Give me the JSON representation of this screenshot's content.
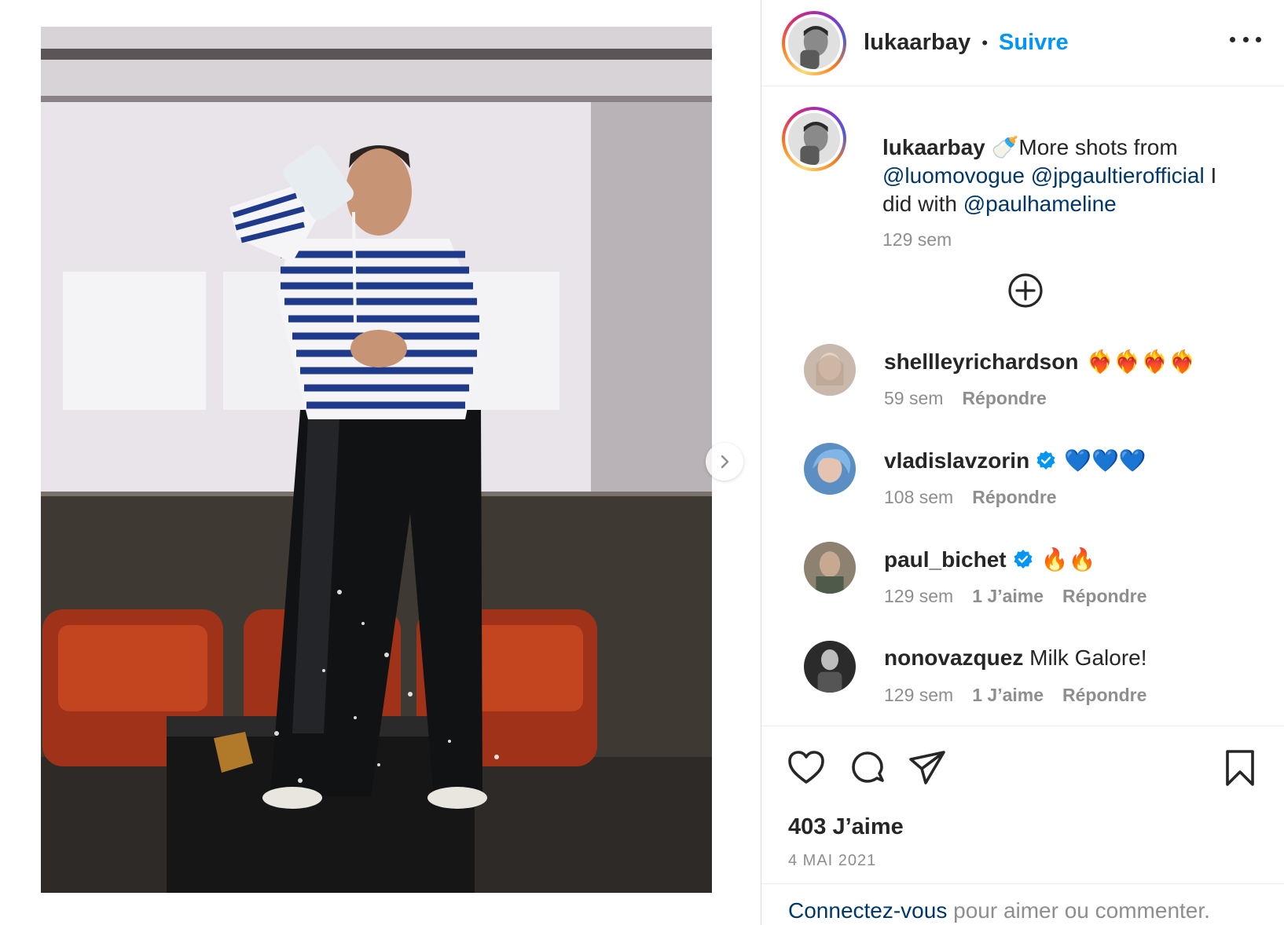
{
  "post": {
    "author": "lukaarbay",
    "separator": "•",
    "follow_label": "Suivre",
    "more_icon": "more-horizontal-icon"
  },
  "caption": {
    "username": "lukaarbay",
    "emoji": "🍼",
    "text_before": "More shots from",
    "mention_1": "@luomovogue",
    "mention_2": "@jpgaultierofficial",
    "text_mid": "I did with",
    "mention_3": "@paulhameline",
    "time": "129 sem"
  },
  "load_more_icon": "plus-circle-icon",
  "comments": [
    {
      "username": "shellleyrichardson",
      "text": "❤️‍🔥❤️‍🔥❤️‍🔥❤️‍🔥",
      "verified": false,
      "time": "59 sem",
      "likes": "",
      "reply": "Répondre"
    },
    {
      "username": "vladislavzorin",
      "text": "💙💙💙",
      "verified": true,
      "time": "108 sem",
      "likes": "",
      "reply": "Répondre"
    },
    {
      "username": "paul_bichet",
      "text": "🔥🔥",
      "verified": true,
      "time": "129 sem",
      "likes": "1 J’aime",
      "reply": "Répondre"
    },
    {
      "username": "nonovazquez",
      "text": "Milk Galore!",
      "verified": false,
      "time": "129 sem",
      "likes": "1 J’aime",
      "reply": "Répondre"
    }
  ],
  "actions": {
    "like_icon": "heart-icon",
    "comment_icon": "comment-icon",
    "share_icon": "send-icon",
    "save_icon": "bookmark-icon",
    "likes_count": "403 J’aime",
    "date": "4 MAI 2021"
  },
  "login": {
    "link": "Connectez-vous",
    "text": " pour aimer ou commenter."
  },
  "colors": {
    "accent": "#0095f6",
    "mention": "#00376b",
    "muted": "#8e8e8e",
    "verified": "#0095f6"
  }
}
